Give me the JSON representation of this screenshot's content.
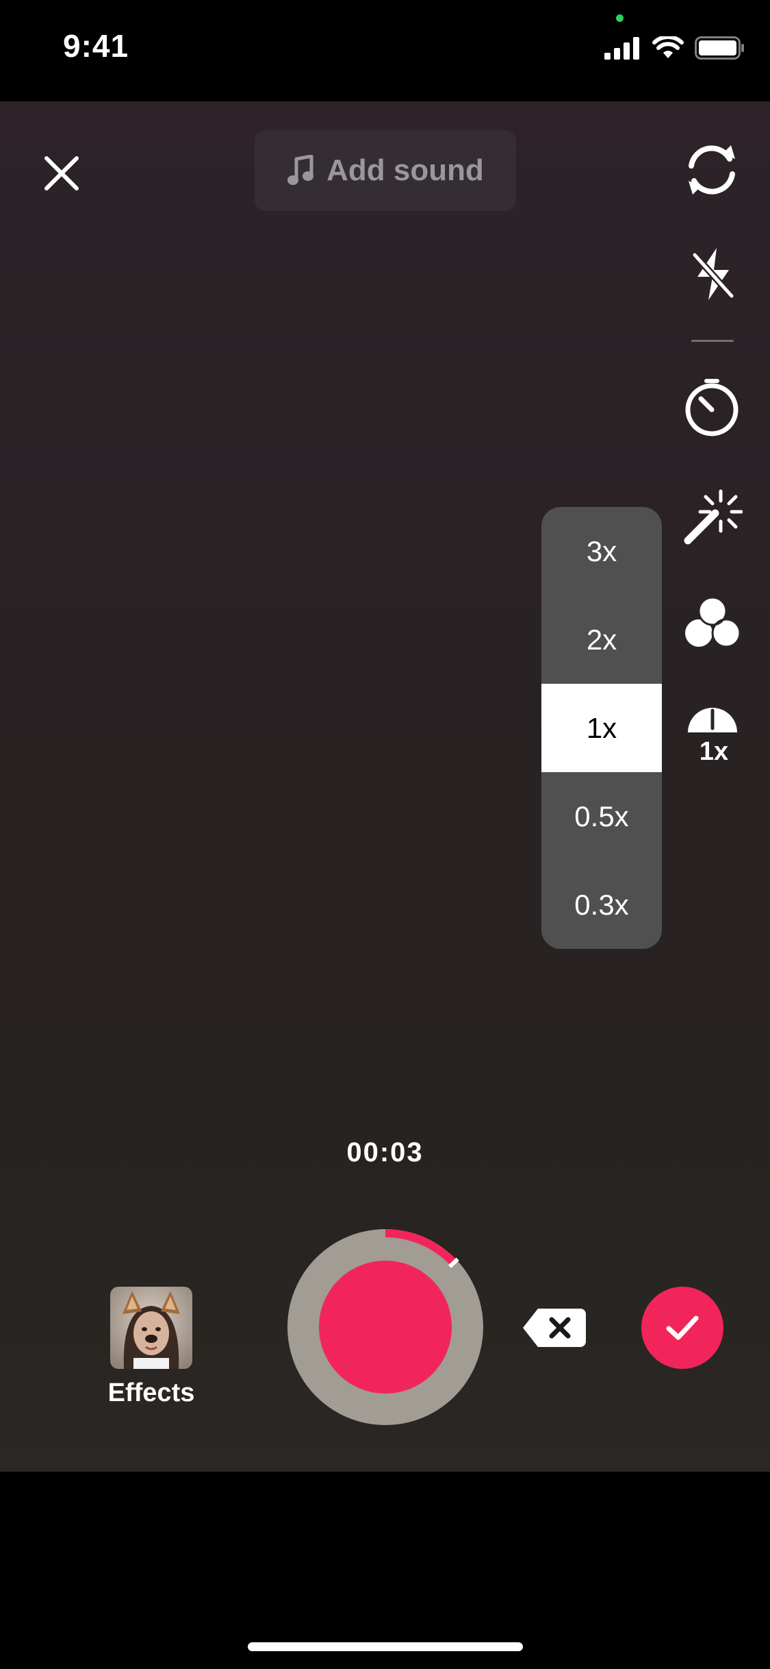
{
  "status_bar": {
    "time": "9:41",
    "icons": [
      "cellular-signal-icon",
      "wifi-icon",
      "battery-icon"
    ]
  },
  "top_bar": {
    "close_icon": "close-icon",
    "add_sound_label": "Add sound",
    "music_icon": "music-note-icon"
  },
  "side_tools": [
    {
      "name": "flip-camera",
      "icon": "flip-camera-icon"
    },
    {
      "name": "flash",
      "icon": "flash-off-icon"
    },
    {
      "name": "timer",
      "icon": "timer-icon"
    },
    {
      "name": "beauty",
      "icon": "magic-wand-icon"
    },
    {
      "name": "filters",
      "icon": "filters-icon"
    },
    {
      "name": "speed",
      "icon": "speed-icon",
      "label": "1x"
    }
  ],
  "speed_options": [
    "3x",
    "2x",
    "1x",
    "0.5x",
    "0.3x"
  ],
  "selected_speed": "1x",
  "recording": {
    "elapsed": "00:03",
    "progress_fraction": 0.13
  },
  "bottom": {
    "effects_label": "Effects",
    "delete_icon": "backspace-delete-icon",
    "confirm_icon": "checkmark-icon"
  },
  "colors": {
    "accent": "#F2255A",
    "record_ring": "#A19C94",
    "speed_panel": "#505050"
  }
}
